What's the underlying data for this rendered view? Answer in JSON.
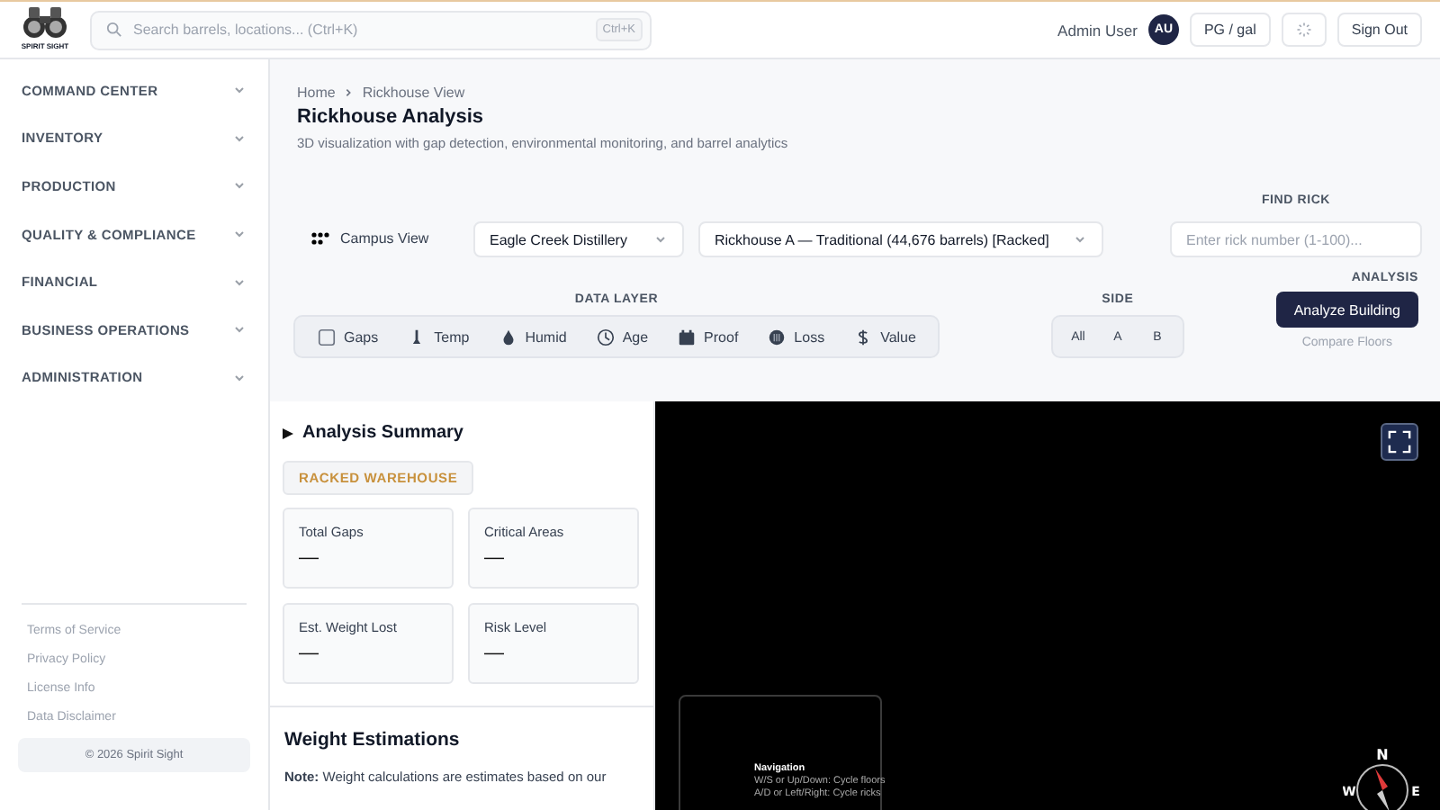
{
  "logo": {
    "text": "SPIRIT SIGHT"
  },
  "search": {
    "placeholder": "Search barrels, locations... (Ctrl+K)",
    "shortcut": "Ctrl+K"
  },
  "user": {
    "name": "Admin User",
    "initials": "AU"
  },
  "header_buttons": [
    {
      "label": "PG / gal",
      "kind": "text"
    },
    {
      "kind": "spinner"
    },
    {
      "label": "Sign Out",
      "kind": "text"
    }
  ],
  "sidebar": {
    "items": [
      {
        "label": "COMMAND CENTER",
        "expanded": false
      },
      {
        "label": "INVENTORY",
        "expanded": false
      },
      {
        "label": "PRODUCTION",
        "expanded": false
      },
      {
        "label": "QUALITY & COMPLIANCE",
        "expanded": false
      },
      {
        "label": "FINANCIAL",
        "expanded": false
      },
      {
        "label": "BUSINESS OPERATIONS",
        "expanded": false
      },
      {
        "label": "ADMINISTRATION",
        "expanded": false
      }
    ],
    "footer_links": [
      "Terms of Service",
      "Privacy Policy",
      "License Info",
      "Data Disclaimer"
    ],
    "copyright": "© 2026 Spirit Sight"
  },
  "breadcrumb": [
    "Home",
    "Rickhouse View"
  ],
  "page_title": "Rickhouse Analysis",
  "page_subtitle": "3D visualization with gap detection, environmental monitoring, and barrel analytics",
  "campus_view": "Campus View",
  "selects": [
    {
      "value": "Eagle Creek Distillery"
    },
    {
      "value": "Rickhouse A — Traditional (44,676 barrels) [Racked]"
    }
  ],
  "find_rick": {
    "label": "FIND RICK",
    "placeholder": "Enter rick number (1-100)..."
  },
  "data_layer": {
    "label": "DATA LAYER",
    "items": [
      {
        "label": "Gaps",
        "kind": "gaps",
        "selected": false
      },
      {
        "label": "Temp",
        "kind": "temp",
        "selected": false
      },
      {
        "label": "Humid",
        "kind": "humid",
        "selected": false
      },
      {
        "label": "Age",
        "kind": "age",
        "selected": false
      },
      {
        "label": "Proof",
        "kind": "proof",
        "selected": false
      },
      {
        "label": "Loss",
        "kind": "loss",
        "selected": false
      },
      {
        "label": "Value",
        "kind": "value",
        "selected": false
      }
    ]
  },
  "side": {
    "label": "SIDE",
    "items": [
      {
        "label": "All",
        "selected": false
      },
      {
        "label": "A",
        "selected": false
      },
      {
        "label": "B",
        "selected": false
      }
    ]
  },
  "analysis": {
    "label": "ANALYSIS",
    "button": "Analyze Building",
    "link": "Compare Floors"
  },
  "summary": {
    "title": "Analysis Summary",
    "expanded": false,
    "badge": "RACKED WAREHOUSE",
    "stats": [
      {
        "label": "Total Gaps",
        "value": "—"
      },
      {
        "label": "Critical Areas",
        "value": "—"
      },
      {
        "label": "Est. Weight Lost",
        "value": "—"
      },
      {
        "label": "Risk Level",
        "value": "—"
      }
    ]
  },
  "weight": {
    "title": "Weight Estimations",
    "note": "**Note:** Weight calculations are estimates based on our"
  },
  "viewer": {
    "navigation": {
      "title": "Navigation",
      "lines": [
        "W/S or Up/Down: Cycle floors",
        "A/D or Left/Right: Cycle ricks"
      ]
    },
    "compass": [
      "N",
      "W",
      "E"
    ]
  }
}
